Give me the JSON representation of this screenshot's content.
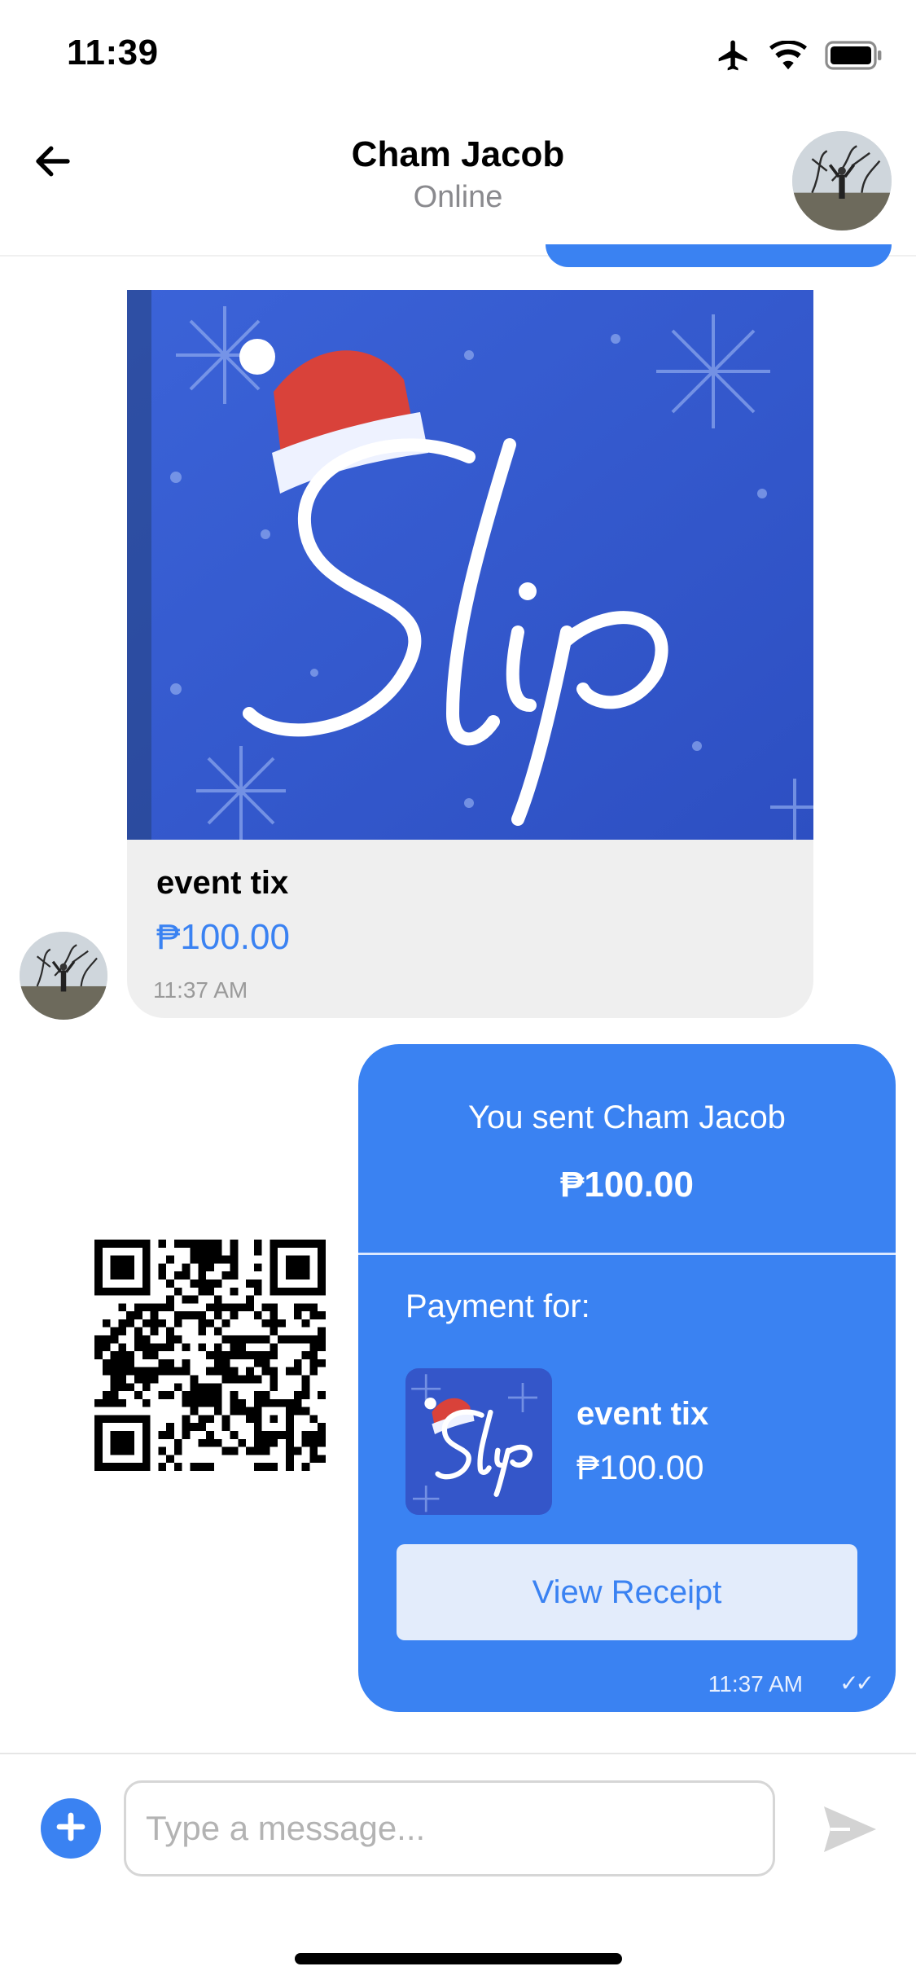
{
  "status_bar": {
    "time": "11:39"
  },
  "header": {
    "title": "Cham Jacob",
    "status": "Online"
  },
  "product_message": {
    "image_logo_text": "Slip",
    "name": "event tix",
    "price": "₱100.00",
    "time": "11:37 AM"
  },
  "payment_message": {
    "sent_text": "You sent Cham Jacob",
    "amount": "₱100.00",
    "payment_for_label": "Payment for:",
    "item_name": "event tix",
    "item_price": "₱100.00",
    "receipt_button_label": "View Receipt",
    "time": "11:37 AM",
    "read_ticks": "✓✓"
  },
  "composer": {
    "placeholder": "Type a message..."
  },
  "colors": {
    "accent": "#3a82f2",
    "bubble_incoming": "#efefef",
    "receipt_button_bg": "#e3ecfb"
  }
}
